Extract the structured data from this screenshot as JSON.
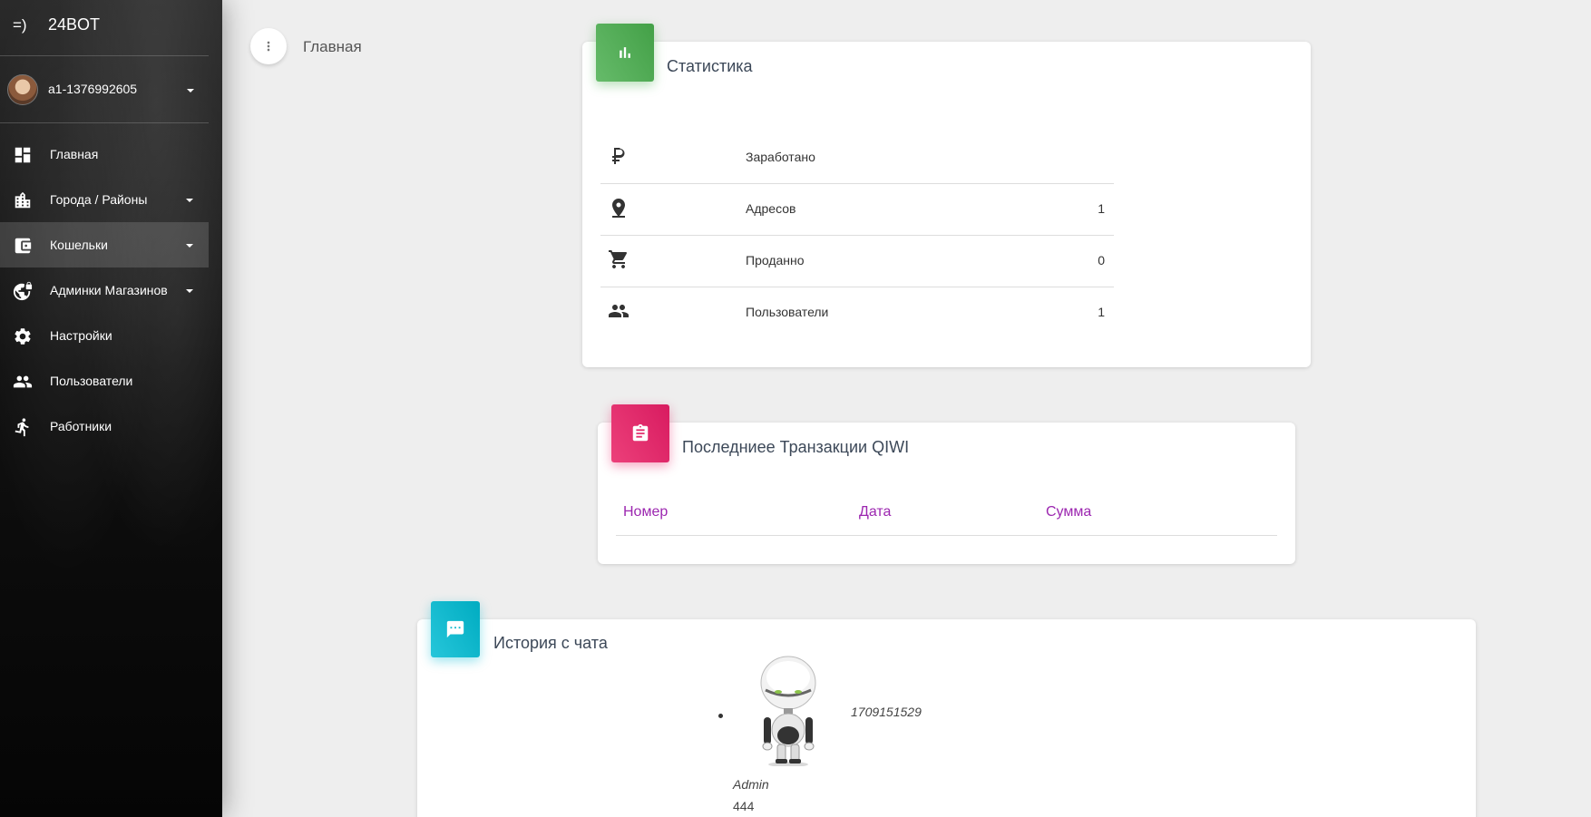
{
  "brand": {
    "mini": "=)",
    "name": "24BOT"
  },
  "user": {
    "name": "a1-1376992605"
  },
  "sidebar": {
    "items": [
      {
        "label": "Главная",
        "icon": "dashboard-icon",
        "has_caret": false,
        "active": false
      },
      {
        "label": "Города / Районы",
        "icon": "city-icon",
        "has_caret": true,
        "active": false
      },
      {
        "label": "Кошельки",
        "icon": "wallet-icon",
        "has_caret": true,
        "active": true
      },
      {
        "label": "Админки Магазинов",
        "icon": "vpn-lock-icon",
        "has_caret": true,
        "active": false
      },
      {
        "label": "Настройки",
        "icon": "gear-icon",
        "has_caret": false,
        "active": false
      },
      {
        "label": "Пользователи",
        "icon": "people-icon",
        "has_caret": false,
        "active": false
      },
      {
        "label": "Работники",
        "icon": "runner-icon",
        "has_caret": false,
        "active": false
      }
    ]
  },
  "header": {
    "title": "Главная"
  },
  "stats_card": {
    "title": "Статистика",
    "color": "#4caf50",
    "rows": [
      {
        "label": "Заработано",
        "value": "",
        "icon": "ruble-icon"
      },
      {
        "label": "Адресов",
        "value": "1",
        "icon": "location-pin-icon"
      },
      {
        "label": "Проданно",
        "value": "0",
        "icon": "cart-icon"
      },
      {
        "label": "Пользователи",
        "value": "1",
        "icon": "people-icon"
      }
    ]
  },
  "qiwi_card": {
    "title": "Последниее Транзакции QIWI",
    "color": "#e91e63",
    "columns": [
      "Номер",
      "Дата",
      "Сумма"
    ]
  },
  "chat_card": {
    "title": "История с чата",
    "color": "#00bcd4",
    "messages": [
      {
        "id": "1709151529",
        "author": "Admin",
        "text": "444"
      }
    ]
  }
}
